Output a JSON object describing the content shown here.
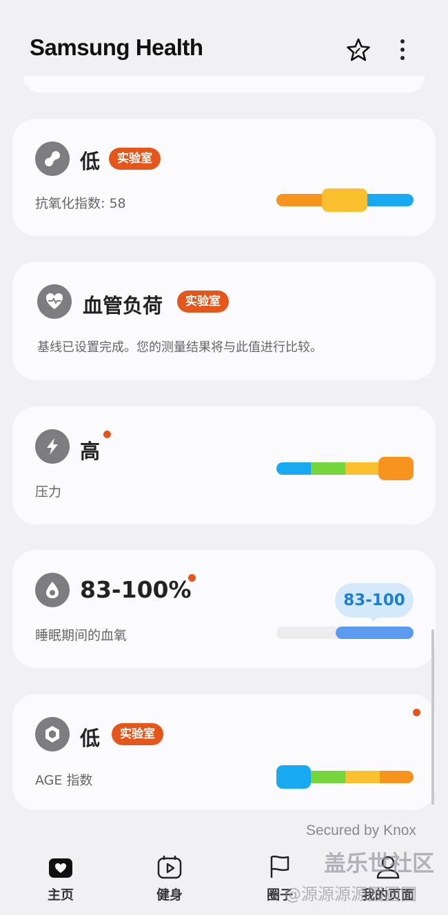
{
  "header": {
    "title": "Samsung Health",
    "star_icon": "star-edit-icon",
    "more_icon": "more-vertical-icon"
  },
  "cards": [
    {
      "id": "antioxidant",
      "icon": "antioxidant-icon",
      "title": "低",
      "badge": "实验室",
      "subtitle": "抗氧化指数: 58",
      "level_segment": 2,
      "colors": [
        "#f7941d",
        "#fbc02d",
        "#18aaf0"
      ]
    },
    {
      "id": "vascular",
      "icon": "heart-vascular-icon",
      "title": "血管负荷",
      "badge": "实验室",
      "subtitle": "基线已设置完成。您的测量结果将与此值进行比较。"
    },
    {
      "id": "stress",
      "icon": "lightning-icon",
      "title": "高",
      "subtitle": "压力",
      "level_segment": 4,
      "colors": [
        "#18aaf0",
        "#74d63c",
        "#fbc02d",
        "#f7941d"
      ]
    },
    {
      "id": "spo2",
      "icon": "oxygen-drop-icon",
      "title": "83-100%",
      "subtitle": "睡眠期间的血氧",
      "range_label": "83-100",
      "range_min": 83,
      "range_max": 100
    },
    {
      "id": "age",
      "icon": "hexagon-icon",
      "title": "低",
      "badge": "实验室",
      "subtitle": "AGE 指数",
      "level_segment": 1,
      "colors": [
        "#18aaf0",
        "#74d63c",
        "#fbc02d",
        "#f7941d"
      ]
    }
  ],
  "secured_by": "Secured by Knox",
  "nav": [
    {
      "label": "主页",
      "icon": "home-heart-icon"
    },
    {
      "label": "健身",
      "icon": "fitness-play-icon"
    },
    {
      "label": "圈子",
      "icon": "flag-icon"
    },
    {
      "label": "我的页面",
      "icon": "person-icon"
    }
  ],
  "watermark": {
    "line1": "盖乐世社区",
    "line2": "@源源源源圆圆圆"
  }
}
